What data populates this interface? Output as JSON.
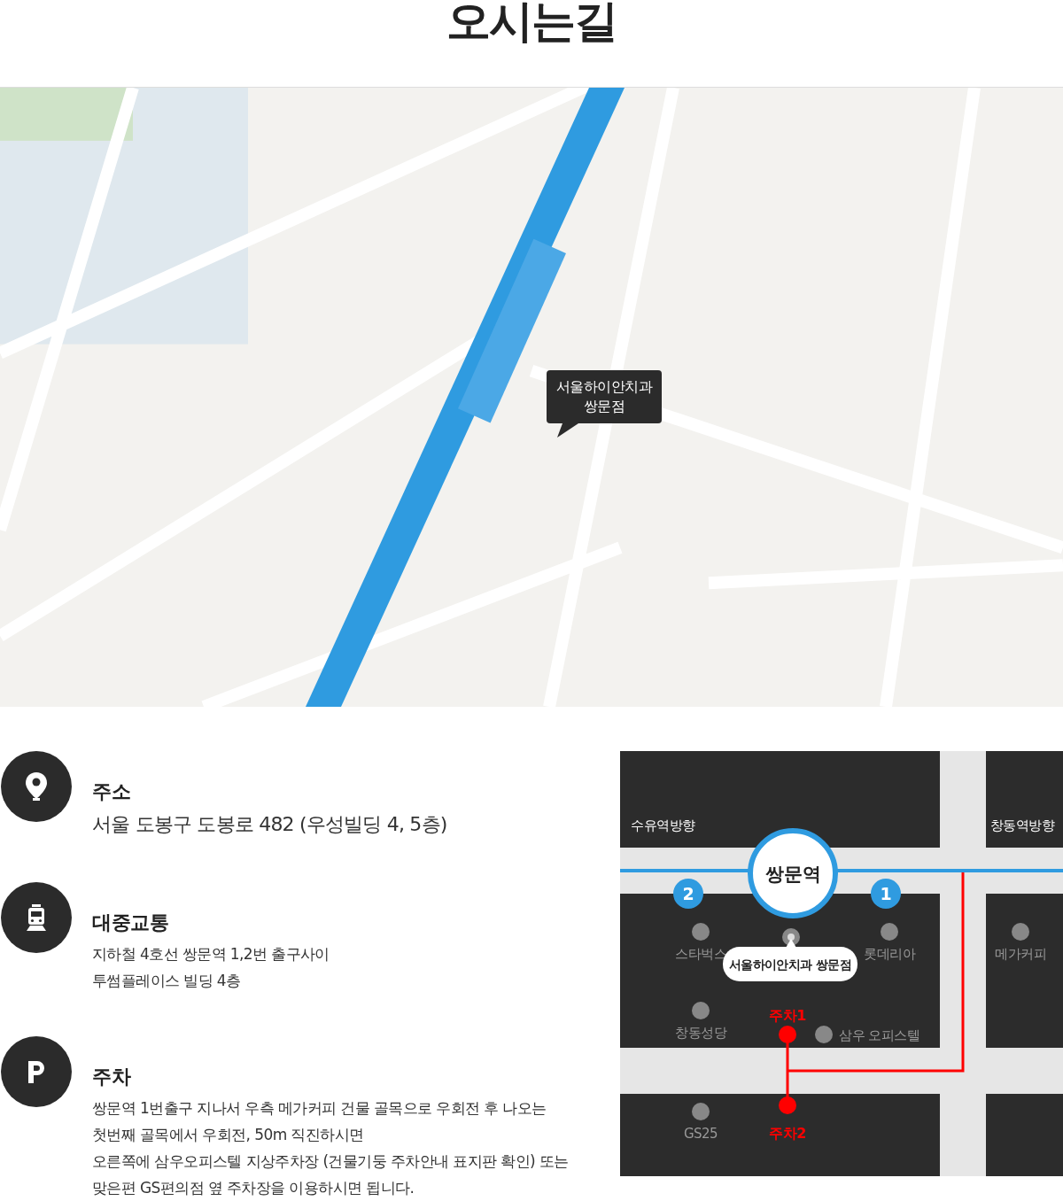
{
  "title": "오시는길",
  "map": {
    "callout": "서울하이안치과 쌍문점"
  },
  "info": [
    {
      "kind": "address",
      "title": "주소",
      "lines": [
        "서울 도봉구 도봉로 482 (우성빌딩 4, 5층)"
      ]
    },
    {
      "kind": "transit",
      "title": "대중교통",
      "lines": [
        "지하철 4호선 쌍문역 1,2번 출구사이",
        "투썸플레이스 빌딩 4층"
      ]
    },
    {
      "kind": "parking",
      "title": "주차",
      "lines": [
        "쌍문역 1번출구 지나서 우측 메가커피 건물 골목으로 우회전 후 나오는",
        "첫번째 골목에서 우회전, 50m 직진하시면",
        "오른쪽에 삼우오피스텔 지상주차장 (건물기둥 주차안내 표지판 확인) 또는",
        "맞은편 GS편의점 옆 주차장을 이용하시면 됩니다."
      ]
    }
  ],
  "diagram": {
    "directions": [
      "수유역방향",
      "창동역방향"
    ],
    "station": "쌍문역",
    "exits": [
      "2",
      "1"
    ],
    "clinic": "서울하이안치과 쌍문점",
    "places": [
      "스타벅스",
      "롯데리아",
      "메가커피",
      "창동성당",
      "삼우 오피스텔",
      "GS25"
    ],
    "parking": [
      "주차1",
      "주차2"
    ]
  }
}
